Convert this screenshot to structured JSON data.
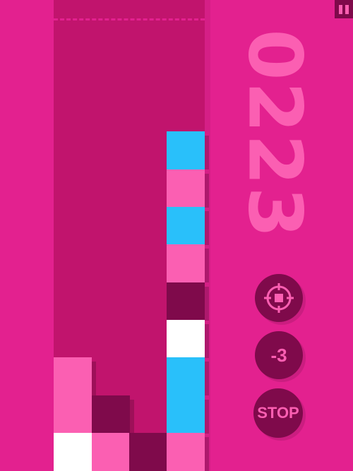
{
  "game": {
    "score": "0223",
    "colors": {
      "background": "#e3218f",
      "well": "#c1146d",
      "pink": "#fb5fb2",
      "cyan": "#29c0fa",
      "dark": "#7f0a4b",
      "white": "#ffffff"
    }
  },
  "controls": {
    "target_icon": "crosshair-icon",
    "minus_label": "-3",
    "stop_label": "STOP",
    "pause_icon": "pause-icon"
  }
}
